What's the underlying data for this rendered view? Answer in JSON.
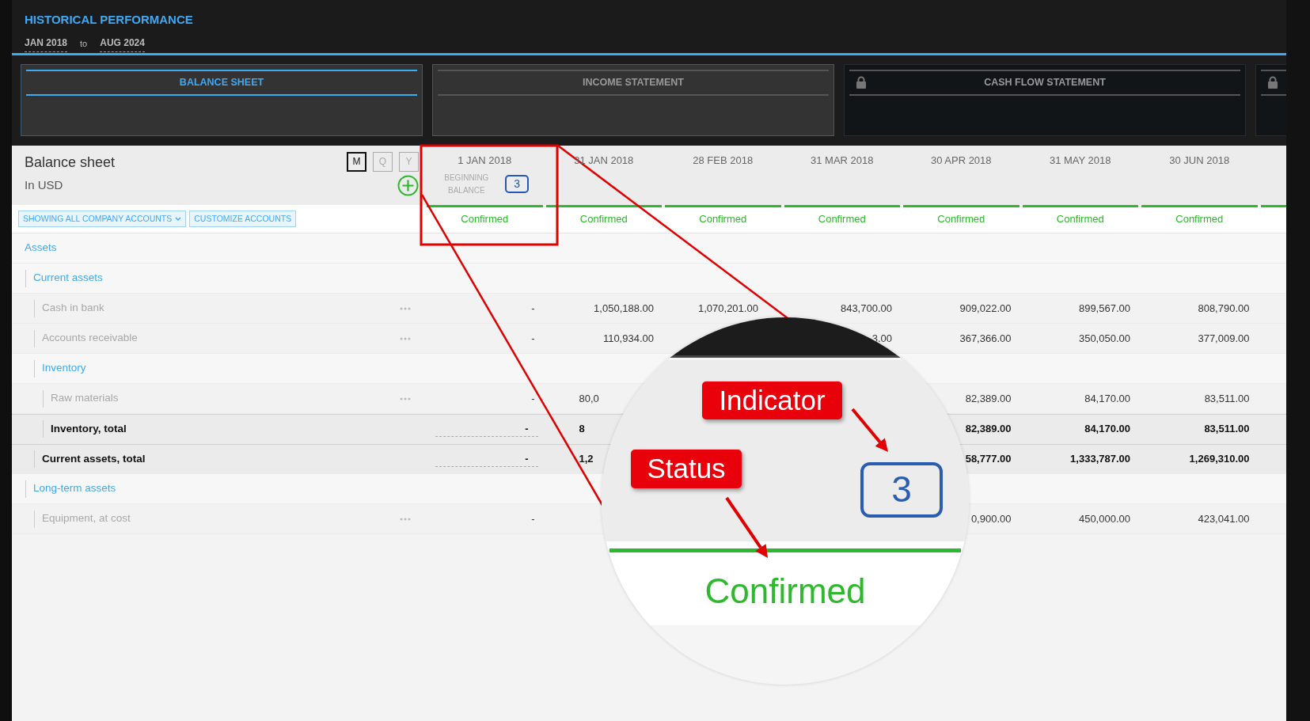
{
  "header": {
    "title": "HISTORICAL PERFORMANCE",
    "range_from": "JAN 2018",
    "range_joiner": "to",
    "range_to": "AUG 2024"
  },
  "tabs": [
    {
      "label": "BALANCE SHEET",
      "selected": true,
      "locked": false
    },
    {
      "label": "INCOME STATEMENT",
      "selected": false,
      "locked": false
    },
    {
      "label": "CASH FLOW STATEMENT",
      "selected": false,
      "locked": true
    },
    {
      "selected": false,
      "locked": true
    }
  ],
  "sheet": {
    "title": "Balance sheet",
    "currency": "In USD",
    "periods": [
      {
        "label": "M",
        "selected": true
      },
      {
        "label": "Q",
        "selected": false
      },
      {
        "label": "Y",
        "selected": false
      }
    ]
  },
  "filters": [
    {
      "label": "SHOWING ALL COMPANY ACCOUNTS",
      "dropdown": true
    },
    {
      "label": "CUSTOMIZE ACCOUNTS",
      "dropdown": false
    }
  ],
  "columns": [
    {
      "date": "1 JAN 2018",
      "note": "BEGINNING BALANCE",
      "indicator": "3",
      "status": "Confirmed",
      "confirmed": true
    },
    {
      "date": "31 JAN 2018",
      "status": "Confirmed",
      "confirmed": true
    },
    {
      "date": "28 FEB 2018",
      "status": "Confirmed",
      "confirmed": true
    },
    {
      "date": "31 MAR 2018",
      "status": "Confirmed",
      "confirmed": true
    },
    {
      "date": "30 APR 2018",
      "status": "Confirmed",
      "confirmed": true
    },
    {
      "date": "31 MAY 2018",
      "status": "Confirmed",
      "confirmed": true
    },
    {
      "date": "30 JUN 2018",
      "status": "Confirmed",
      "confirmed": true
    },
    {
      "confirmed": true
    }
  ],
  "rows": [
    {
      "label": "Assets",
      "kind": "group",
      "children": [
        {
          "label": "Current assets",
          "kind": "group",
          "children": [
            {
              "label": "Cash in bank",
              "kind": "account",
              "values": [
                "-",
                "1,050,188.00",
                "1,070,201.00",
                "843,700.00",
                "909,022.00",
                "899,567.00",
                "808,790.00"
              ]
            },
            {
              "label": "Accounts receivable",
              "kind": "account",
              "values": [
                "-",
                "110,934.00"
              ],
              "values_end": [
                "3.00",
                "367,366.00",
                "350,050.00",
                "377,009.00"
              ]
            },
            {
              "label": "Inventory",
              "kind": "group",
              "children": [
                {
                  "label": "Raw materials",
                  "kind": "account",
                  "values": [
                    "-",
                    "80,0"
                  ],
                  "values_end": [
                    "82,389.00",
                    "84,170.00",
                    "83,511.00"
                  ]
                },
                {
                  "label": "Inventory, total",
                  "kind": "total",
                  "values": [
                    "-",
                    "8"
                  ],
                  "values_end": [
                    "82,389.00",
                    "84,170.00",
                    "83,511.00"
                  ]
                }
              ]
            },
            {
              "label": "Current assets, total",
              "kind": "total",
              "values": [
                "-",
                "1,2"
              ],
              "values_end": [
                "58,777.00",
                "1,333,787.00",
                "1,269,310.00"
              ]
            }
          ]
        },
        {
          "label": "Long-term assets",
          "kind": "group",
          "children": [
            {
              "label": "Equipment, at cost",
              "kind": "account",
              "values": [
                "-"
              ],
              "values_end": [
                "0,900.00",
                "450,000.00",
                "423,041.00"
              ]
            }
          ]
        }
      ]
    }
  ],
  "annotation": {
    "callouts": [
      {
        "label": "Indicator"
      },
      {
        "label": "Status"
      }
    ],
    "zoom_indicator": "3",
    "zoom_status": "Confirmed",
    "zoom_confirmed": true
  }
}
